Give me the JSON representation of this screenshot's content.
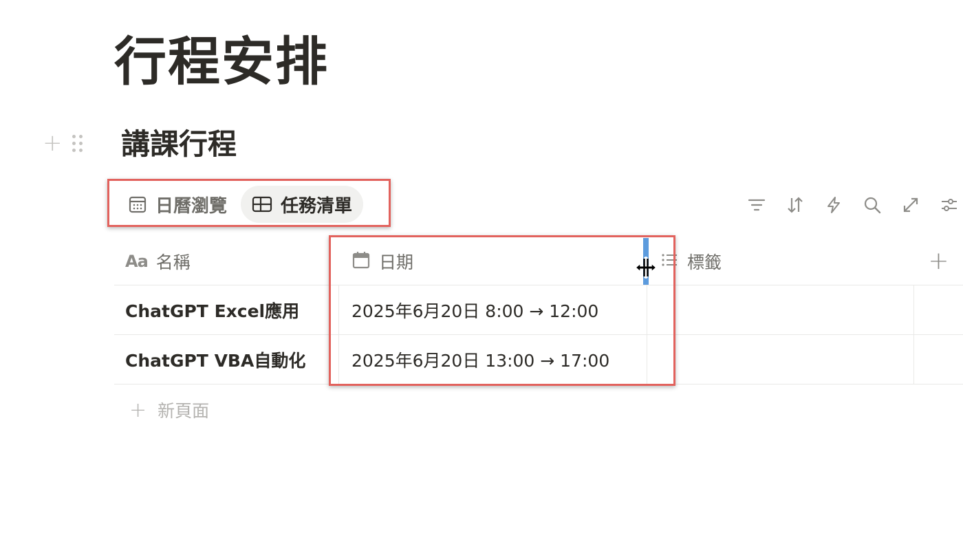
{
  "page": {
    "title": "行程安排"
  },
  "section": {
    "title": "講課行程"
  },
  "views": {
    "tabs": [
      {
        "label": "日曆瀏覽",
        "icon": "calendar-icon",
        "active": false
      },
      {
        "label": "任務清單",
        "icon": "table-icon",
        "active": true
      }
    ]
  },
  "toolbar": {
    "icons": [
      "filter-icon",
      "sort-icon",
      "automation-icon",
      "search-icon",
      "expand-icon",
      "settings-icon"
    ]
  },
  "table": {
    "columns": [
      {
        "label": "名稱",
        "icon": "text-property-icon"
      },
      {
        "label": "日期",
        "icon": "calendar-icon"
      },
      {
        "label": "標籤",
        "icon": "list-icon"
      }
    ],
    "rows": [
      {
        "name": "ChatGPT Excel應用",
        "date": "2025年6月20日 8:00 → 12:00",
        "tag": ""
      },
      {
        "name": "ChatGPT VBA自動化",
        "date": "2025年6月20日 13:00 → 17:00",
        "tag": ""
      }
    ],
    "add_column_label": "+",
    "name_icon_text": "Aa"
  },
  "new_page": {
    "label": "新頁面",
    "plus": "+"
  },
  "handle": {
    "plus": "+"
  },
  "colors": {
    "highlight": "#e2625d",
    "resize_bar": "#4a90d9"
  }
}
